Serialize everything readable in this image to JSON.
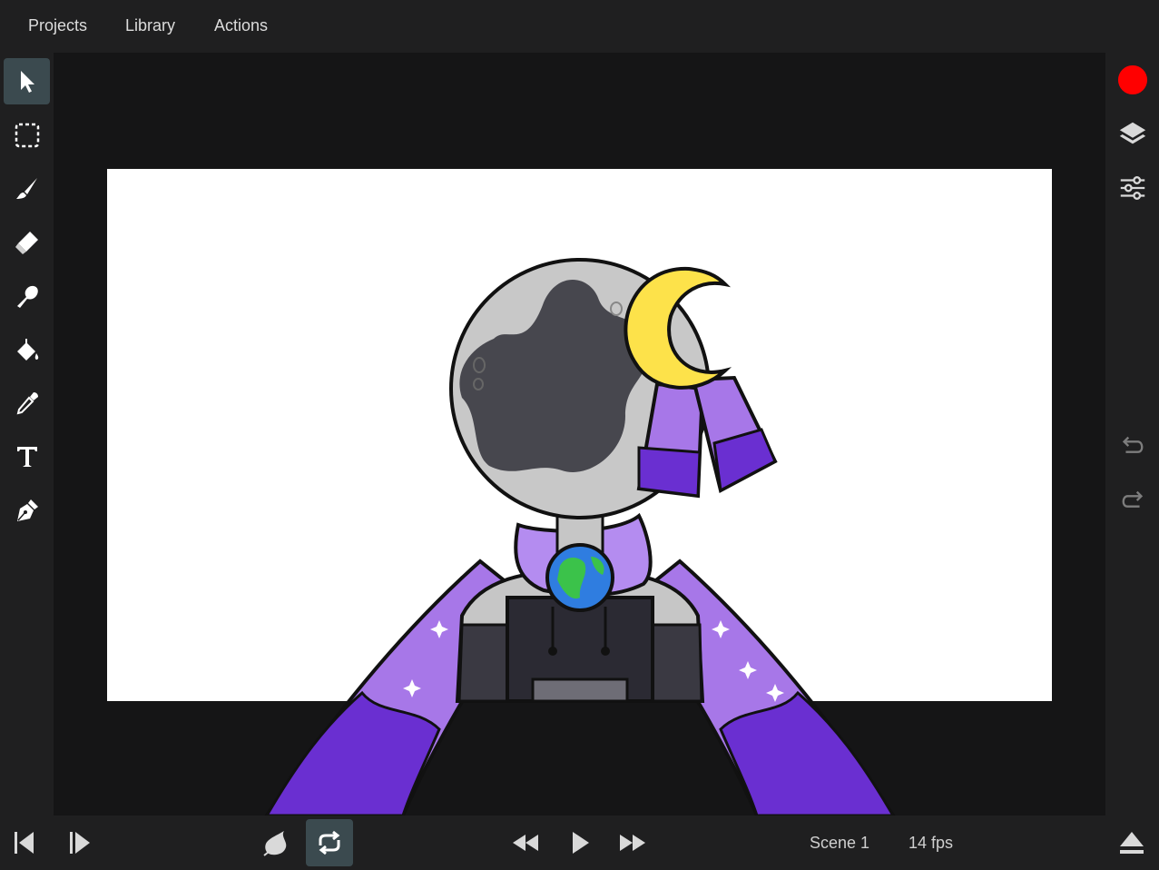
{
  "menu": {
    "projects": "Projects",
    "library": "Library",
    "actions": "Actions"
  },
  "tools": [
    "select-tool",
    "lasso-tool",
    "brush-tool",
    "eraser-tool",
    "smudge-tool",
    "fill-tool",
    "eyedropper-tool",
    "text-tool",
    "pen-tool"
  ],
  "tools_active": "select-tool",
  "right": [
    "record-button",
    "layers-icon",
    "adjustments-icon",
    "undo-icon",
    "redo-icon"
  ],
  "footer": {
    "scene_label": "Scene 1",
    "fps_label": "14 fps"
  },
  "colors": {
    "accent_active": "#3b4a4f",
    "record": "#ff0000",
    "canvas": "#ffffff",
    "stage": "#151516"
  }
}
